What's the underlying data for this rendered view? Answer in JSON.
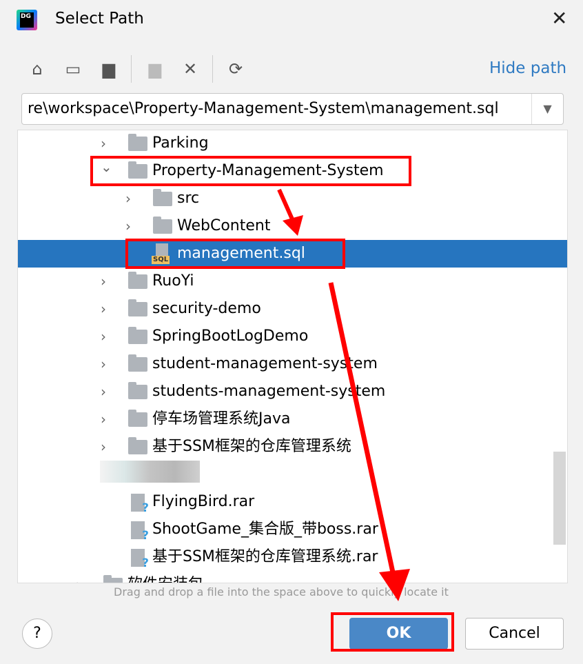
{
  "window": {
    "title": "Select Path",
    "logo_text": "DG"
  },
  "toolbar": {
    "icons": [
      "home-icon",
      "desktop-icon",
      "project-folder-icon",
      "new-folder-icon",
      "delete-icon",
      "refresh-icon"
    ],
    "hide_path": "Hide path"
  },
  "path_field": {
    "value": "re\\workspace\\Property-Management-System\\management.sql"
  },
  "tree": {
    "rows": [
      {
        "label": "Parking",
        "type": "folder",
        "expanded": false
      },
      {
        "label": "Property-Management-System",
        "type": "folder",
        "expanded": true
      },
      {
        "label": "src",
        "type": "folder",
        "expanded": false
      },
      {
        "label": "WebContent",
        "type": "folder",
        "expanded": false
      },
      {
        "label": "management.sql",
        "type": "sql",
        "selected": true,
        "badge": "SQL"
      },
      {
        "label": "RuoYi",
        "type": "folder"
      },
      {
        "label": "security-demo",
        "type": "folder"
      },
      {
        "label": "SpringBootLogDemo",
        "type": "folder"
      },
      {
        "label": "student-management-system",
        "type": "folder"
      },
      {
        "label": "students-management-system",
        "type": "folder"
      },
      {
        "label": "停车场管理系统Java",
        "type": "folder"
      },
      {
        "label": "基于SSM框架的仓库管理系统",
        "type": "folder"
      },
      {
        "label": "FlyingBird.rar",
        "type": "file"
      },
      {
        "label": "ShootGame_集合版_带boss.rar",
        "type": "file"
      },
      {
        "label": "基于SSM框架的仓库管理系统.rar",
        "type": "file"
      },
      {
        "label": "软件安装包",
        "type": "folder"
      }
    ]
  },
  "hint": "Drag and drop a file into the space above to quickly locate it",
  "buttons": {
    "help": "?",
    "ok": "OK",
    "cancel": "Cancel"
  },
  "colors": {
    "selection": "#2675bf",
    "accent": "#2f7ac2",
    "annotation": "#ff0000"
  }
}
